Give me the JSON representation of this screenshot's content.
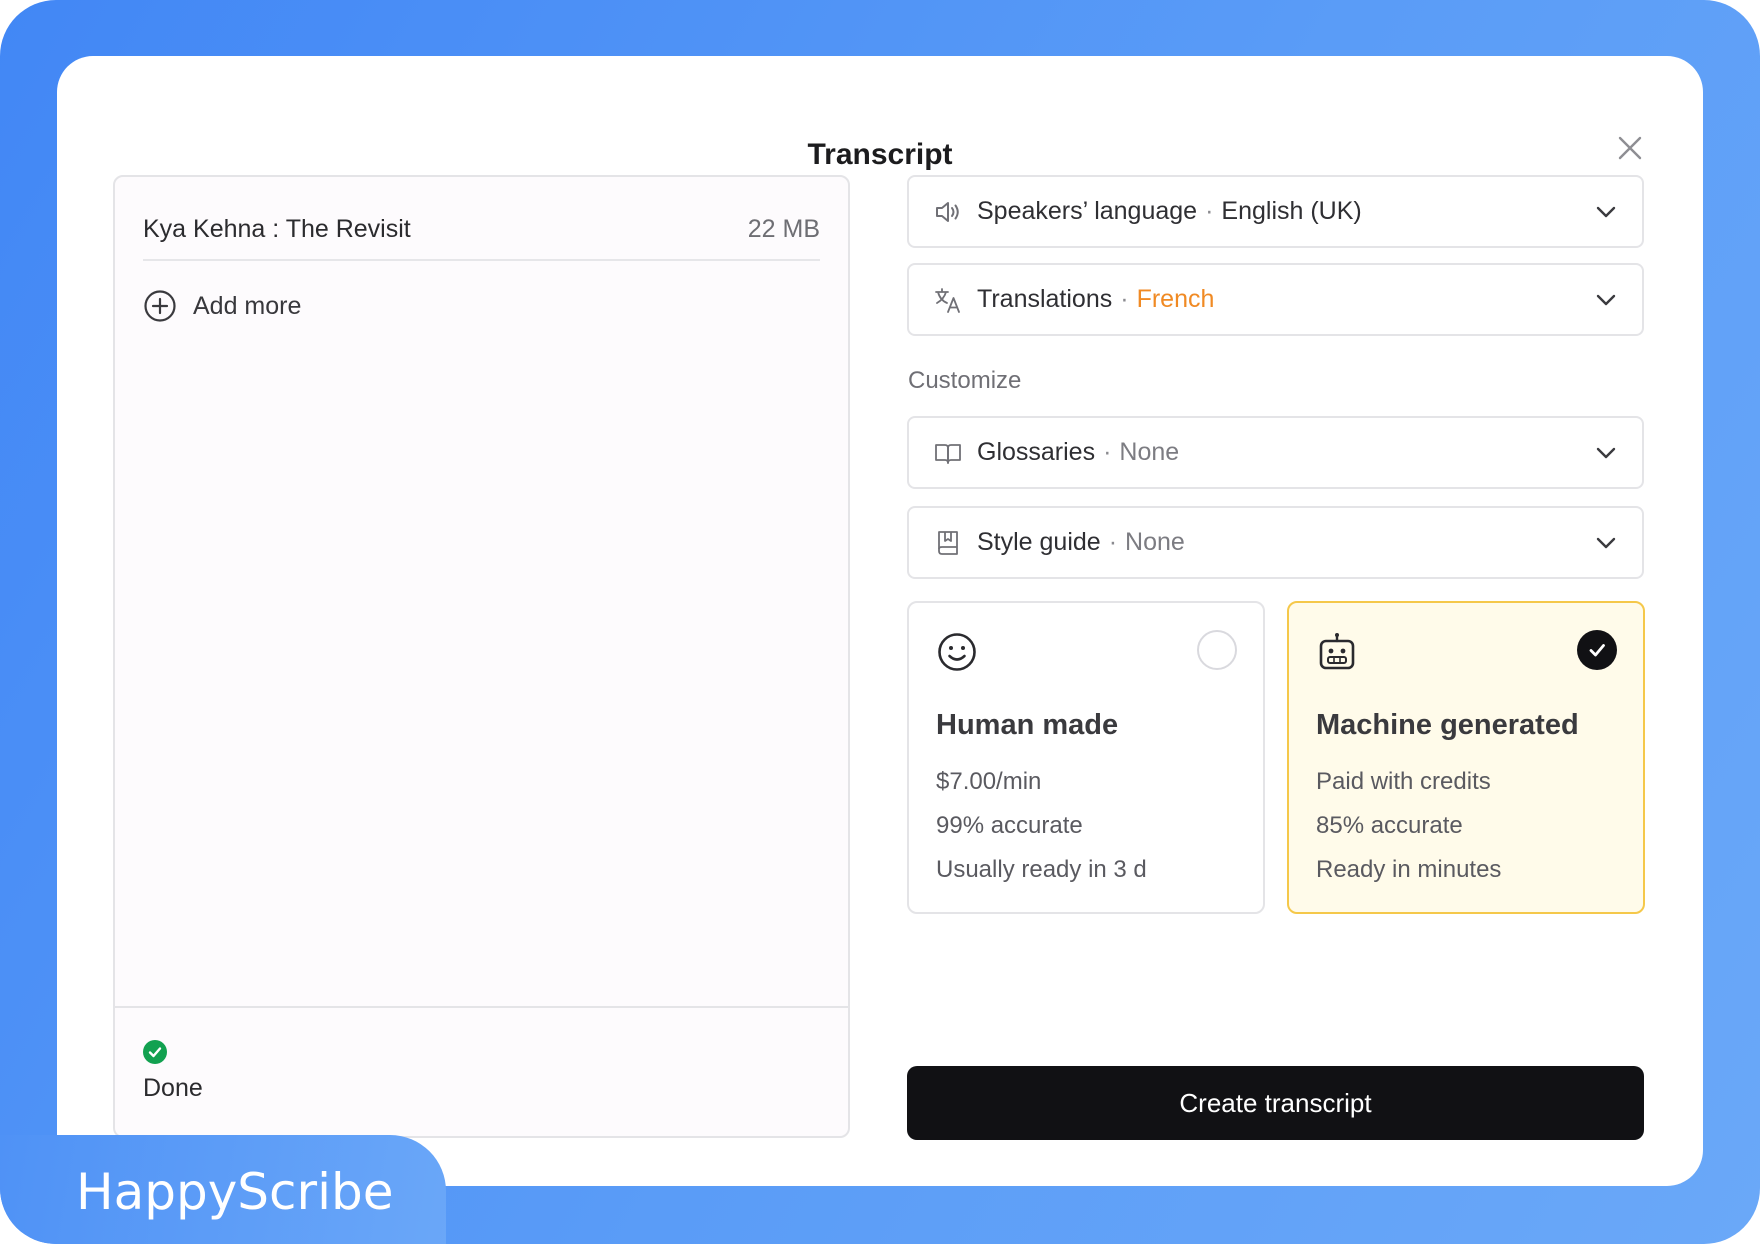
{
  "modal": {
    "title": "Transcript"
  },
  "file_panel": {
    "file": {
      "name": "Kya Kehna : The Revisit",
      "size": "22 MB"
    },
    "add_more_label": "Add more",
    "status": "Done"
  },
  "settings": {
    "speakers_language": {
      "label": "Speakers’ language",
      "separator": "·",
      "value": "English (UK)"
    },
    "translations": {
      "label": "Translations",
      "separator": "·",
      "value": "French"
    },
    "customize_label": "Customize",
    "glossaries": {
      "label": "Glossaries",
      "separator": "·",
      "value": "None"
    },
    "style_guide": {
      "label": "Style guide",
      "separator": "·",
      "value": "None"
    }
  },
  "options": {
    "human": {
      "icon": "smiley-icon",
      "title": "Human made",
      "price": "$7.00/min",
      "accuracy": "99% accurate",
      "turnaround": "Usually ready in 3 d",
      "selected": false
    },
    "machine": {
      "icon": "robot-icon",
      "title": "Machine generated",
      "price": "Paid with credits",
      "accuracy": "85% accurate",
      "turnaround": "Ready in minutes",
      "selected": true
    }
  },
  "actions": {
    "create_label": "Create transcript"
  },
  "brand": {
    "name": "HappyScribe"
  },
  "colors": {
    "background_gradient_start": "#4287f5",
    "background_gradient_end": "#6aa8f8",
    "accent_orange": "#f08a24",
    "selected_card_border": "#f5c84a",
    "selected_card_fill": "#fffbea",
    "primary_button": "#111114",
    "status_green": "#12a150"
  }
}
